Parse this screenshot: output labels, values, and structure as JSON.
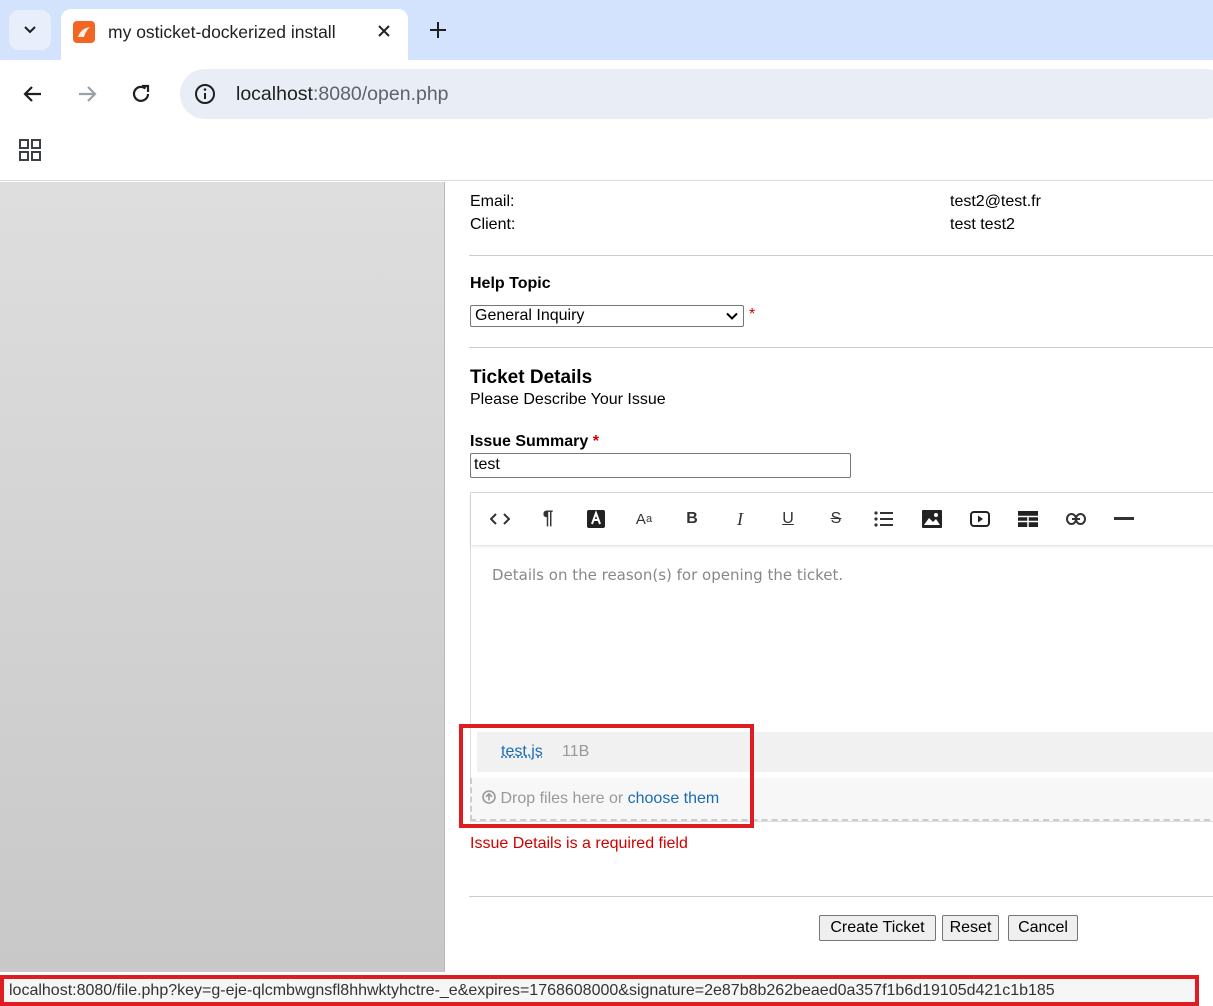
{
  "browser": {
    "tab_title": "my osticket-dockerized install",
    "url_host": "localhost",
    "url_rest": ":8080/open.php"
  },
  "user": {
    "email_label": "Email:",
    "email_value": "test2@test.fr",
    "client_label": "Client:",
    "client_value": "test test2"
  },
  "help_topic": {
    "label": "Help Topic",
    "selected": "General Inquiry",
    "required_mark": "*"
  },
  "ticket_details": {
    "title": "Ticket Details",
    "subtitle": "Please Describe Your Issue",
    "summary_label": "Issue Summary",
    "summary_required": "*",
    "summary_value": "test",
    "details_placeholder": "Details on the reason(s) for opening the ticket.",
    "toolbar_icons": [
      "code-icon",
      "paragraph-icon",
      "font-color-icon",
      "font-size-icon",
      "bold-icon",
      "italic-icon",
      "underline-icon",
      "strikethrough-icon",
      "list-icon",
      "image-icon",
      "video-icon",
      "table-icon",
      "link-icon",
      "horizontal-rule-icon"
    ]
  },
  "attachment": {
    "file_name": "test.js",
    "file_size": "11B",
    "drop_text": "Drop files here or ",
    "drop_link": "choose them"
  },
  "error": "Issue Details is a required field",
  "buttons": {
    "create": "Create Ticket",
    "reset": "Reset",
    "cancel": "Cancel"
  },
  "status_url": "localhost:8080/file.php?key=g-eje-qlcmbwgnsfl8hhwktyhctre-_e&expires=1768608000&signature=2e87b8b262beaed0a357f1b6d19105d421c1b185",
  "colors": {
    "accent_red": "#e01c23",
    "error_red": "#d20000",
    "link_blue": "#1a6cb4",
    "tabstrip": "#d3e3fd"
  }
}
